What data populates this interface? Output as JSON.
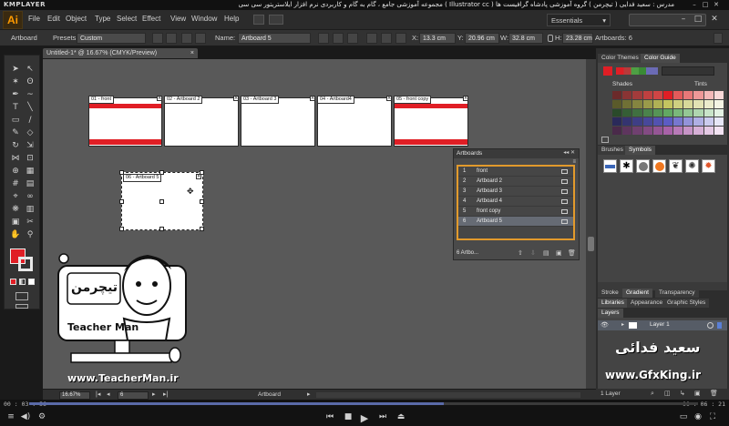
{
  "player": {
    "name": "KMPLAYER",
    "title": "مجموعه آموزشی جامع ، گام به گام و کاربردی نرم افزار ایلاستریتور سی سی ( Illustrator cc )   مدرس : سعید فدایی ( تیچرمن ) گروه آموزشی پادشاه گرافیست ها",
    "time_current": "00 : 03 : 56",
    "time_total": "00 : 06 : 21",
    "progress": 0.62
  },
  "app": {
    "logo": "Ai",
    "menu": [
      "File",
      "Edit",
      "Object",
      "Type",
      "Select",
      "Effect",
      "View",
      "Window",
      "Help"
    ],
    "workspace": "Essentials"
  },
  "controlbar": {
    "tool_label": "Artboard",
    "presets_label": "Presets:",
    "presets_value": "Custom",
    "name_label": "Name:",
    "name_value": "Artboard 5",
    "x_label": "X:",
    "x_value": "13.3 cm",
    "y_label": "Y:",
    "y_value": "20.96 cm",
    "w_label": "W:",
    "w_value": "32.8 cm",
    "h_label": "H:",
    "h_value": "23.28 cm",
    "artboards_label": "Artboards:",
    "artboards_count": "6"
  },
  "document": {
    "tab_title": "Untitled-1* @ 16.67% (CMYK/Preview)"
  },
  "artboards_canvas": [
    {
      "label": "01 - front"
    },
    {
      "label": "02 - Artboard 2"
    },
    {
      "label": "03 - Artboard 3"
    },
    {
      "label": "04 - Artboard4"
    },
    {
      "label": "05 - front copy"
    },
    {
      "label": "06 - Artboard 5"
    }
  ],
  "artboards_panel": {
    "title": "Artboards",
    "rows": [
      {
        "num": "1",
        "name": "front"
      },
      {
        "num": "2",
        "name": "Artboard 2"
      },
      {
        "num": "3",
        "name": "Artboard 3"
      },
      {
        "num": "4",
        "name": "Artboard 4"
      },
      {
        "num": "5",
        "name": "front copy"
      },
      {
        "num": "6",
        "name": "Artboard 5"
      }
    ],
    "selected_index": 5,
    "footer": "6 Artbo..."
  },
  "right_panels": {
    "color_tabs": [
      "Color Themes",
      "Color Guide"
    ],
    "shades_label": "Shades",
    "tints_label": "Tints",
    "brush_tabs": [
      "Brushes",
      "Symbols"
    ],
    "stroke_tabs": [
      "Stroke",
      "Gradient",
      "Transparency"
    ],
    "lib_tabs": [
      "Libraries",
      "Appearance",
      "Graphic Styles"
    ],
    "layers_tab": "Layers",
    "layer_name": "Layer 1",
    "layers_footer": "1 Layer"
  },
  "statusbar": {
    "zoom": "16.67%",
    "artboard_num": "6",
    "mode": "Artboard"
  },
  "overlay": {
    "teacher_brand": "Teacher Man",
    "teacher_persian": "تیچرمن",
    "teacher_url": "www.TeacherMan.ir",
    "signature": "سعید فدائی",
    "gfx_url": "www.GfxKing.ir"
  },
  "colors": {
    "accent_red": "#e01e25",
    "panel_highlight": "#e29a2c",
    "ai_orange": "#ff9a00"
  }
}
